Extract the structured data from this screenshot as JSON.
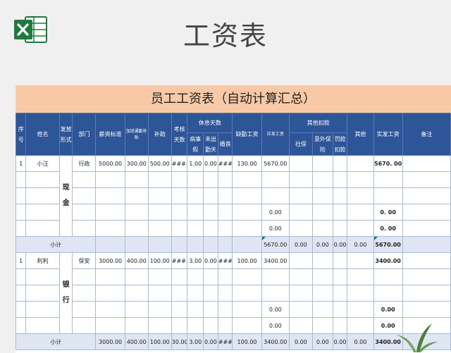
{
  "page_title": "工资表",
  "sheet_title": "员工工资表（自动计算汇总）",
  "headers": {
    "seq": "序号",
    "name": "姓名",
    "pay_method": "发放形式",
    "dept": "部门",
    "base_salary": "薪资标准",
    "overtime_allowance": "加班通勤补贴",
    "allowance": "补助",
    "attendance_days": "考核天数",
    "leave_days": "休息天数",
    "sick_leave": "病事假",
    "absent": "未出勤天",
    "marriage_leave": "婚丧",
    "absence_pay": "缺勤工资",
    "payable": "应发工资",
    "other_deductions": "其他扣款",
    "social_security": "社保",
    "accident_insurance": "意外保险",
    "penalty": "罚款扣款",
    "other": "其他",
    "actual_pay": "实发工资",
    "remarks": "备注"
  },
  "groups": [
    {
      "seq": "1",
      "name": "小汪",
      "pay_method": "现金",
      "dept": "行政",
      "base_salary": "5000.00",
      "overtime_allowance": "300.00",
      "allowance": "500.00",
      "attendance_days": "####",
      "sick_leave": "1.00",
      "absent": "0.00",
      "marriage_leave": "###",
      "absence_pay": "130.00",
      "payable": "5670.00",
      "actual_pay": "5670. 00",
      "extra_payable": [
        "0.00",
        "0.00"
      ],
      "extra_actual": [
        "0. 00",
        "0. 00"
      ],
      "subtotal": {
        "label": "小计",
        "base_salary": "",
        "overtime_allowance": "",
        "allowance": "",
        "attendance_days": "",
        "sick_leave": "",
        "absent": "",
        "marriage_leave": "",
        "absence_pay": "",
        "payable": "5670.00",
        "social_security": "0.00",
        "accident_insurance": "0.00",
        "penalty": "0.00",
        "other": "0.00",
        "actual_pay": "5670.00"
      }
    },
    {
      "seq": "1",
      "name": "利利",
      "pay_method": "银行",
      "dept": "保安",
      "base_salary": "3000.00",
      "overtime_allowance": "400.00",
      "allowance": "100.00",
      "attendance_days": "####",
      "sick_leave": "3.00",
      "absent": "0.00",
      "marriage_leave": "###",
      "absence_pay": "100.00",
      "payable": "3400.00",
      "actual_pay": "3400.00",
      "extra_payable": [
        "0.00",
        "0.00"
      ],
      "extra_actual": [
        "0.00",
        "0.00"
      ],
      "subtotal": {
        "label": "小计",
        "base_salary": "3000.00",
        "overtime_allowance": "400.00",
        "allowance": "100.00",
        "attendance_days": "30.00",
        "sick_leave": "3.00",
        "absent": "0.00",
        "marriage_leave": "###",
        "absence_pay": "100.00",
        "payable": "3400.00",
        "social_security": "0.00",
        "accident_insurance": "0.00",
        "penalty": "0.00",
        "other": "0.00",
        "actual_pay": "3400.00"
      }
    }
  ],
  "colors": {
    "header_blue": "#2e5597",
    "banner_peach": "#f8c9a7",
    "subtotal_fill": "#dfe6f2",
    "excel_green": "#1f7a3f"
  }
}
